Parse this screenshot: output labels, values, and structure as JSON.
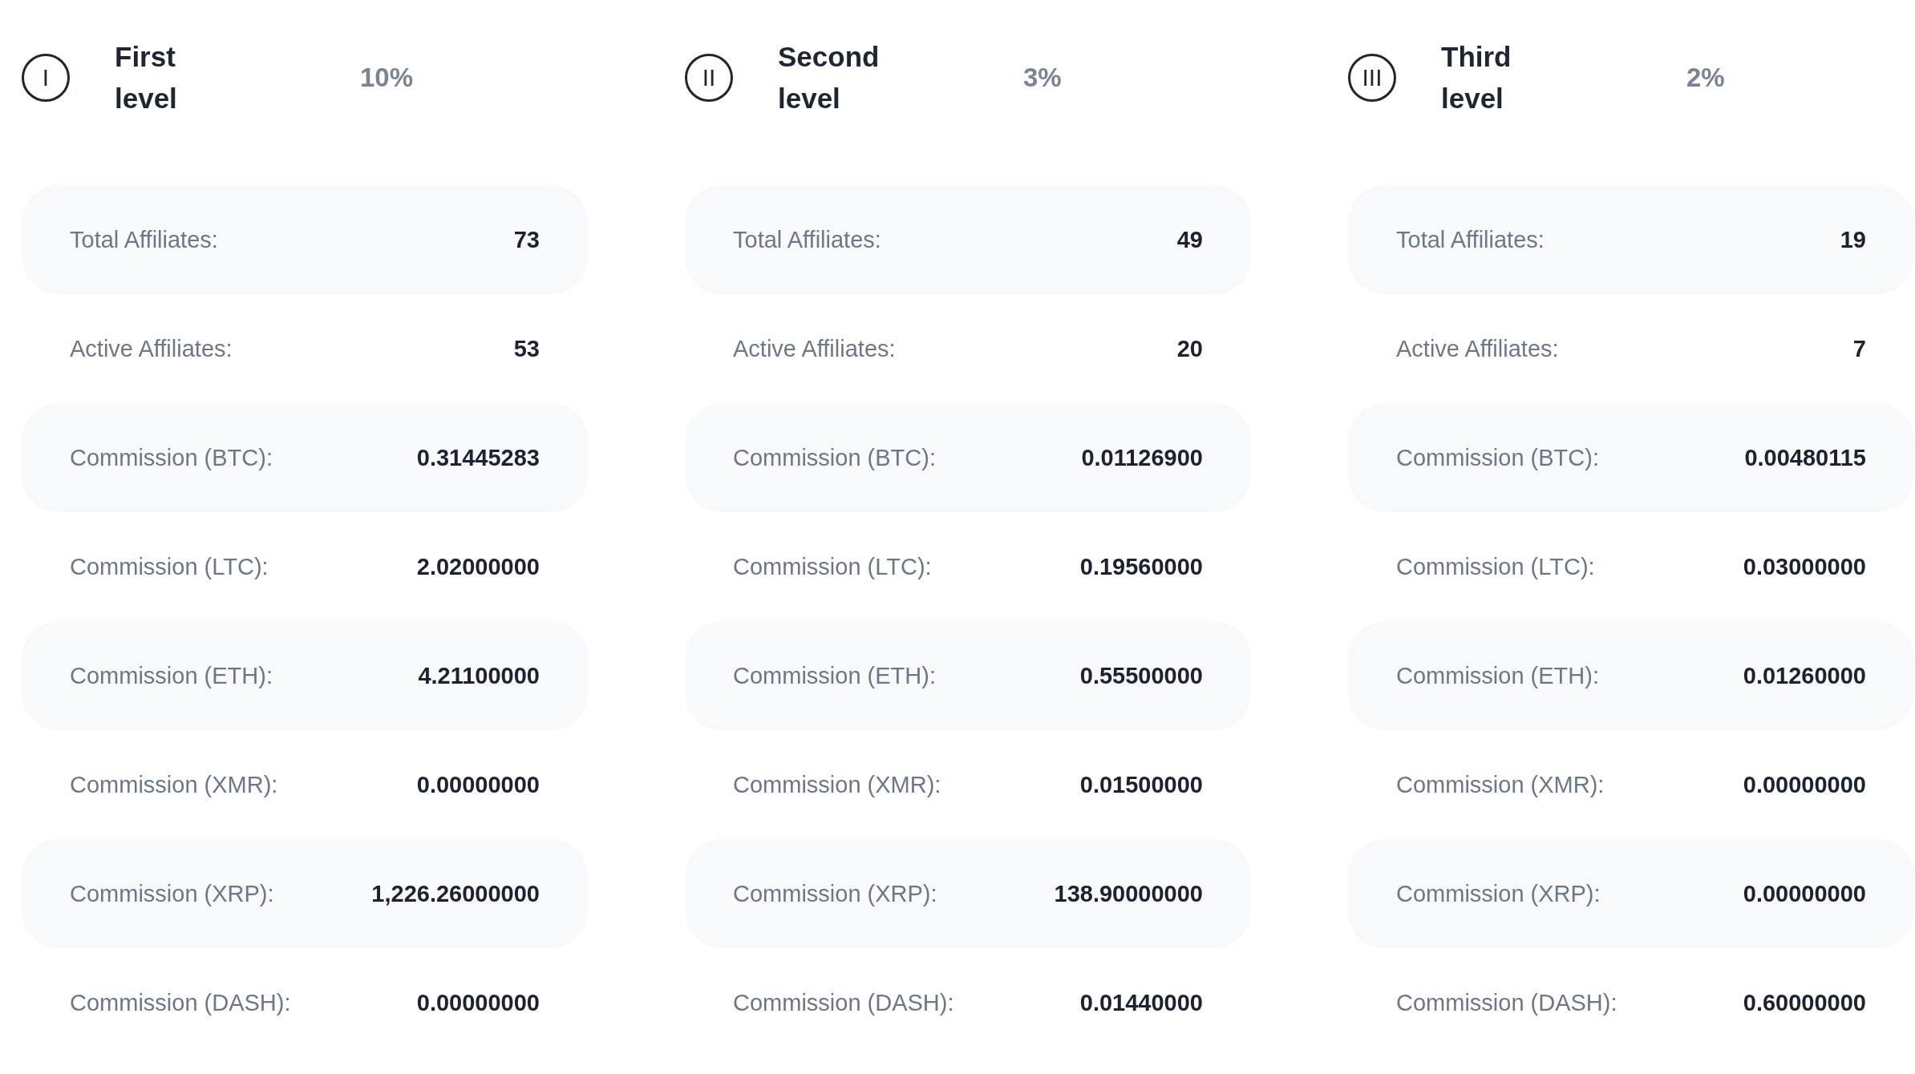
{
  "levels": [
    {
      "numeral": "I",
      "title": "First level",
      "percent": "10%",
      "rows": [
        {
          "label": "Total Affiliates:",
          "value": "73"
        },
        {
          "label": "Active Affiliates:",
          "value": "53"
        },
        {
          "label": "Commission (BTC):",
          "value": "0.31445283"
        },
        {
          "label": "Commission (LTC):",
          "value": "2.02000000"
        },
        {
          "label": "Commission (ETH):",
          "value": "4.21100000"
        },
        {
          "label": "Commission (XMR):",
          "value": "0.00000000"
        },
        {
          "label": "Commission (XRP):",
          "value": "1,226.26000000"
        },
        {
          "label": "Commission (DASH):",
          "value": "0.00000000"
        }
      ]
    },
    {
      "numeral": "II",
      "title": "Second level",
      "percent": "3%",
      "rows": [
        {
          "label": "Total Affiliates:",
          "value": "49"
        },
        {
          "label": "Active Affiliates:",
          "value": "20"
        },
        {
          "label": "Commission (BTC):",
          "value": "0.01126900"
        },
        {
          "label": "Commission (LTC):",
          "value": "0.19560000"
        },
        {
          "label": "Commission (ETH):",
          "value": "0.55500000"
        },
        {
          "label": "Commission (XMR):",
          "value": "0.01500000"
        },
        {
          "label": "Commission (XRP):",
          "value": "138.90000000"
        },
        {
          "label": "Commission (DASH):",
          "value": "0.01440000"
        }
      ]
    },
    {
      "numeral": "III",
      "title": "Third level",
      "percent": "2%",
      "rows": [
        {
          "label": "Total Affiliates:",
          "value": "19"
        },
        {
          "label": "Active Affiliates:",
          "value": "7"
        },
        {
          "label": "Commission (BTC):",
          "value": "0.00480115"
        },
        {
          "label": "Commission (LTC):",
          "value": "0.03000000"
        },
        {
          "label": "Commission (ETH):",
          "value": "0.01260000"
        },
        {
          "label": "Commission (XMR):",
          "value": "0.00000000"
        },
        {
          "label": "Commission (XRP):",
          "value": "0.00000000"
        },
        {
          "label": "Commission (DASH):",
          "value": "0.60000000"
        }
      ]
    }
  ]
}
